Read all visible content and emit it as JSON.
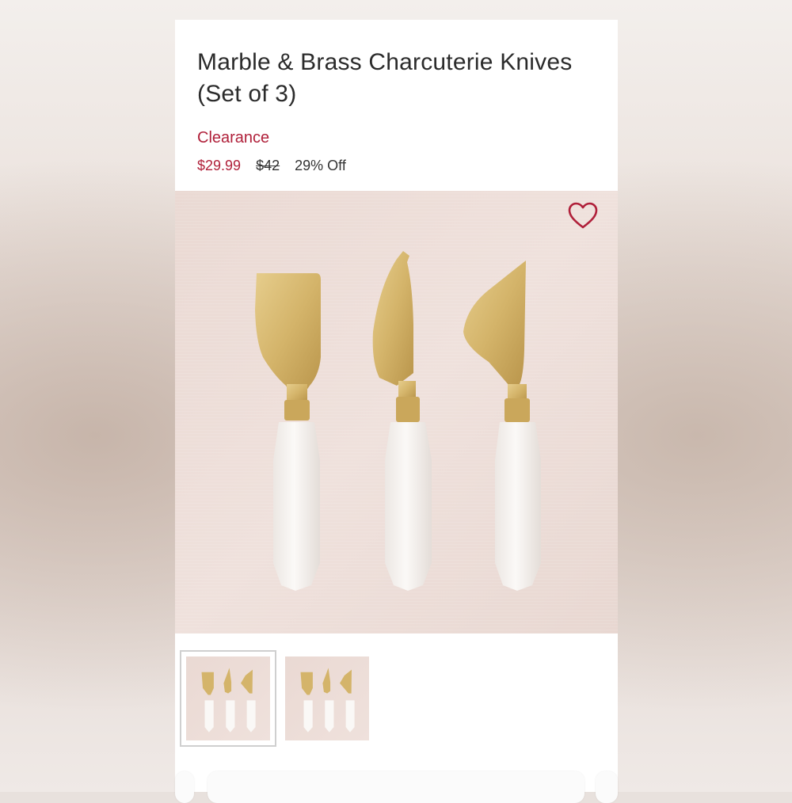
{
  "product": {
    "title": "Marble & Brass Charcuterie Knives (Set of 3)",
    "badge": "Clearance",
    "price_sale": "$29.99",
    "price_original": "$42",
    "discount": "29% Off"
  },
  "colors": {
    "accent": "#b0203a",
    "text": "#2b2b2b",
    "brass": "#d4b46a",
    "marble": "#f6f3f0"
  },
  "icons": {
    "favorite": "heart-outline-icon"
  },
  "thumbnails": [
    {
      "selected": true
    },
    {
      "selected": false
    }
  ]
}
